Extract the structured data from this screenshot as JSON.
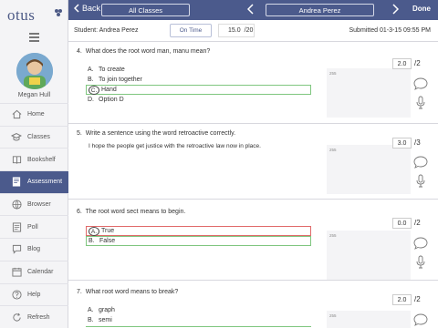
{
  "sidebar": {
    "logo": "otus",
    "user_name": "Megan Hull",
    "items": [
      {
        "label": "Home",
        "icon": "home-icon"
      },
      {
        "label": "Classes",
        "icon": "classes-icon"
      },
      {
        "label": "Bookshelf",
        "icon": "bookshelf-icon"
      },
      {
        "label": "Assessment",
        "icon": "assessment-icon",
        "active": true
      },
      {
        "label": "Browser",
        "icon": "browser-icon"
      },
      {
        "label": "Poll",
        "icon": "poll-icon"
      },
      {
        "label": "Blog",
        "icon": "blog-icon"
      },
      {
        "label": "Calendar",
        "icon": "calendar-icon"
      },
      {
        "label": "Help",
        "icon": "help-icon"
      },
      {
        "label": "Refresh",
        "icon": "refresh-icon"
      }
    ]
  },
  "topbar": {
    "back_label": "Back",
    "class_selector": "All Classes",
    "student_selector": "Andrea Perez",
    "done_label": "Done"
  },
  "student_bar": {
    "student_label": "Student: Andrea Perez",
    "status": "On Time",
    "score": "15.0",
    "total": "/20",
    "submitted": "Submitted 01-3-15 09:55 PM"
  },
  "questions": [
    {
      "number": "4.",
      "text": "What does the root word man, manu mean?",
      "options": [
        {
          "letter": "A.",
          "text": "To create"
        },
        {
          "letter": "B.",
          "text": "To join together"
        },
        {
          "letter": "C.",
          "text": "Hand",
          "selected": true,
          "correct": true
        },
        {
          "letter": "D.",
          "text": "Option D"
        }
      ],
      "char_count": "255",
      "score": "2.0",
      "max": "/2"
    },
    {
      "number": "5.",
      "text": "Write a sentence using the word retroactive correctly.",
      "answer": "I hope the people get justice with the retroactive law now in place.",
      "char_count": "255",
      "score": "3.0",
      "max": "/3"
    },
    {
      "number": "6.",
      "text": "The root word sect means to begin.",
      "options": [
        {
          "letter": "A.",
          "text": "True",
          "selected": true,
          "wrong": true
        },
        {
          "letter": "B.",
          "text": "False",
          "correct": true
        }
      ],
      "char_count": "255",
      "score": "0.0",
      "max": "/2"
    },
    {
      "number": "7.",
      "text": "What root word means to break?",
      "options": [
        {
          "letter": "A.",
          "text": "graph"
        },
        {
          "letter": "B.",
          "text": "semi"
        }
      ],
      "char_count": "255",
      "score": "2.0",
      "max": "/2"
    }
  ],
  "colors": {
    "brand": "#4b5a8c",
    "correct": "#7fc67f",
    "wrong": "#e06a6a"
  }
}
